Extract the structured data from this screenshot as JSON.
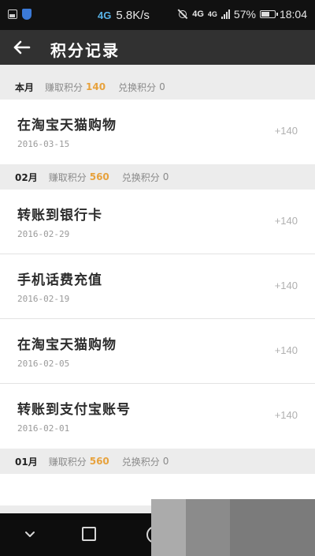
{
  "status_bar": {
    "network": "4G",
    "speed": "5.8K/s",
    "network_right": "4G",
    "network_small": "4G",
    "battery": "57%",
    "battery_level": 0.57,
    "time": "18:04"
  },
  "header": {
    "title": "积分记录"
  },
  "sections": [
    {
      "month": "本月",
      "earn_label": "赚取积分",
      "earn_value": "140",
      "redeem_label": "兑换积分",
      "redeem_value": "0",
      "records": [
        {
          "name": "在淘宝天猫购物",
          "date": "2016-03-15",
          "points": "+140"
        }
      ]
    },
    {
      "month": "02月",
      "earn_label": "赚取积分",
      "earn_value": "560",
      "redeem_label": "兑换积分",
      "redeem_value": "0",
      "records": [
        {
          "name": "转账到银行卡",
          "date": "2016-02-29",
          "points": "+140"
        },
        {
          "name": "手机话费充值",
          "date": "2016-02-19",
          "points": "+140"
        },
        {
          "name": "在淘宝天猫购物",
          "date": "2016-02-05",
          "points": "+140"
        },
        {
          "name": "转账到支付宝账号",
          "date": "2016-02-01",
          "points": "+140"
        }
      ]
    },
    {
      "month": "01月",
      "earn_label": "赚取积分",
      "earn_value": "560",
      "redeem_label": "兑换积分",
      "redeem_value": "0",
      "records": []
    }
  ],
  "colors": {
    "header_bg": "#313131",
    "accent": "#e7a23d",
    "status_bg": "#111111",
    "nav_bg": "#0d0d0d",
    "section_bg": "#ececec"
  },
  "icons": {
    "back": "arrow-left-icon",
    "nav_back": "chevron-down-icon",
    "nav_recent": "square-icon",
    "nav_home": "circle-icon"
  }
}
